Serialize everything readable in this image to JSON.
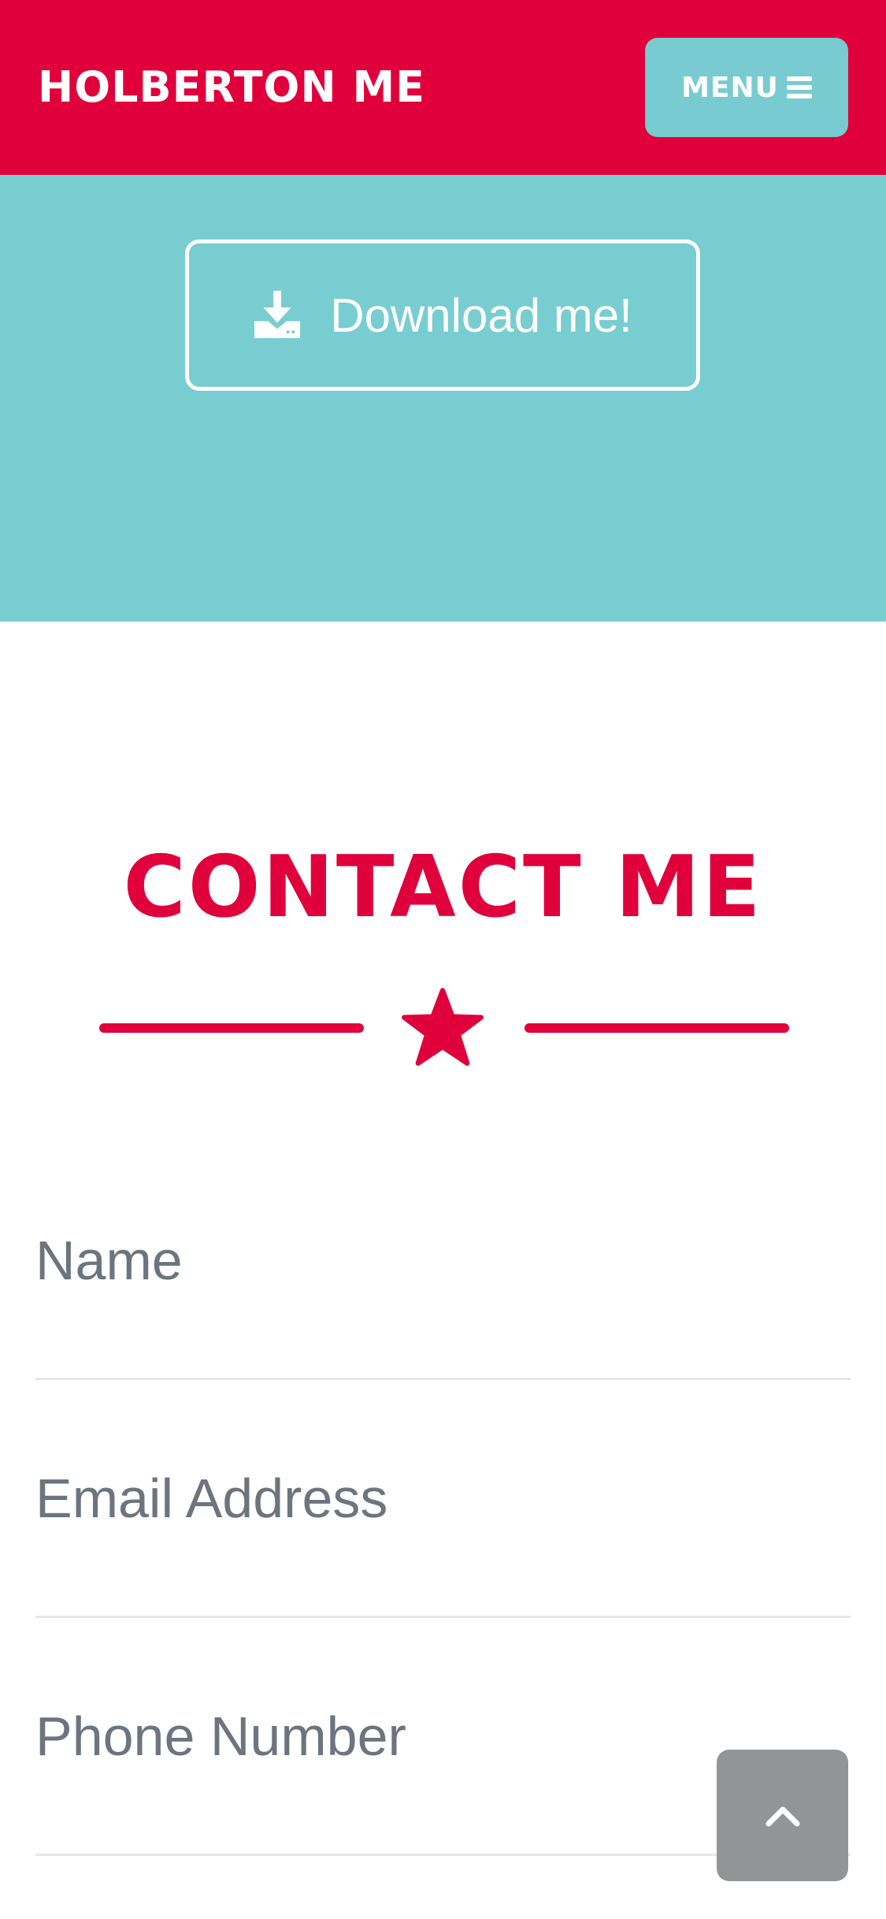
{
  "navbar": {
    "brand": "HOLBERTON ME",
    "menu_label": "MENU",
    "menu_icon": "bars-icon",
    "background": "#e0003b",
    "button_color": "#78cbd0"
  },
  "hero": {
    "background": "#78cdd1",
    "download_label": "Download me!",
    "download_icon": "download-icon"
  },
  "contact": {
    "title": "CONTACT ME",
    "divider_icon": "star-icon",
    "accent": "#e0003b",
    "fields": [
      {
        "placeholder": "Name"
      },
      {
        "placeholder": "Email Address"
      },
      {
        "placeholder": "Phone Number"
      }
    ]
  },
  "scroll_top": {
    "icon": "chevron-up-icon",
    "background": "#929496"
  }
}
